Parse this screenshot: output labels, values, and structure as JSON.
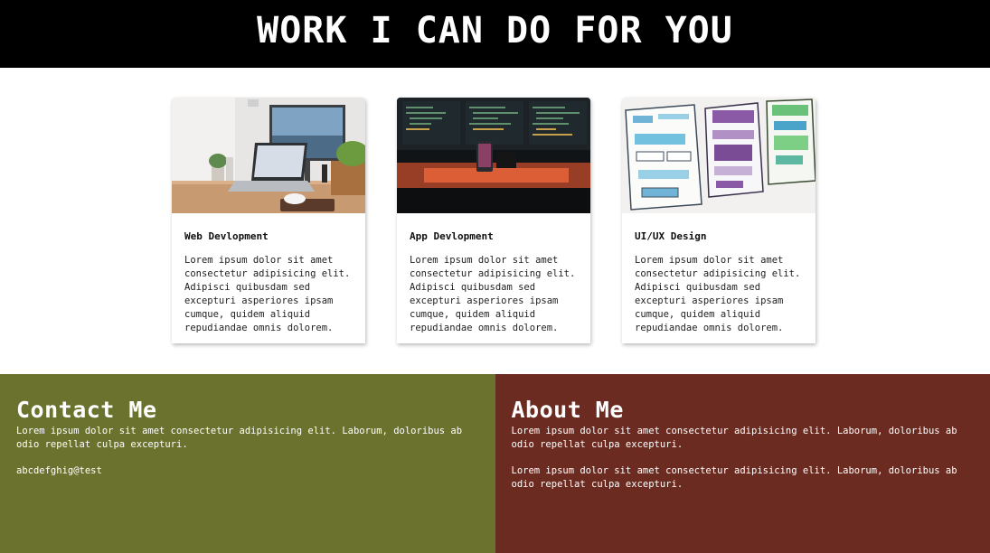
{
  "header": {
    "title": "WORK I CAN DO FOR YOU"
  },
  "cards": [
    {
      "title": "Web Devlopment",
      "text": "Lorem ipsum dolor sit amet consectetur adipisicing elit. Adipisci quibusdam sed excepturi asperiores ipsam cumque, quidem aliquid repudiandae omnis dolorem.",
      "image": "desk-laptop-monitor-photo"
    },
    {
      "title": "App Devlopment",
      "text": "Lorem ipsum dolor sit amet consectetur adipisicing elit. Adipisci quibusdam sed excepturi asperiores ipsam cumque, quidem aliquid repudiandae omnis dolorem.",
      "image": "code-screens-phone-photo"
    },
    {
      "title": "UI/UX Design",
      "text": "Lorem ipsum dolor sit amet consectetur adipisicing elit. Adipisci quibusdam sed excepturi asperiores ipsam cumque, quidem aliquid repudiandae omnis dolorem.",
      "image": "wireframe-sketches-photo"
    }
  ],
  "contact": {
    "heading": "Contact Me",
    "text": "Lorem ipsum dolor sit amet consectetur adipisicing elit. Laborum, doloribus ab odio repellat culpa excepturi.",
    "email": "abcdefghig@test",
    "color": "#6b722d"
  },
  "about": {
    "heading": "About Me",
    "text1": "Lorem ipsum dolor sit amet consectetur adipisicing elit. Laborum, doloribus ab odio repellat culpa excepturi.",
    "text2": "Lorem ipsum dolor sit amet consectetur adipisicing elit. Laborum, doloribus ab odio repellat culpa excepturi.",
    "color": "#6b2b20"
  }
}
